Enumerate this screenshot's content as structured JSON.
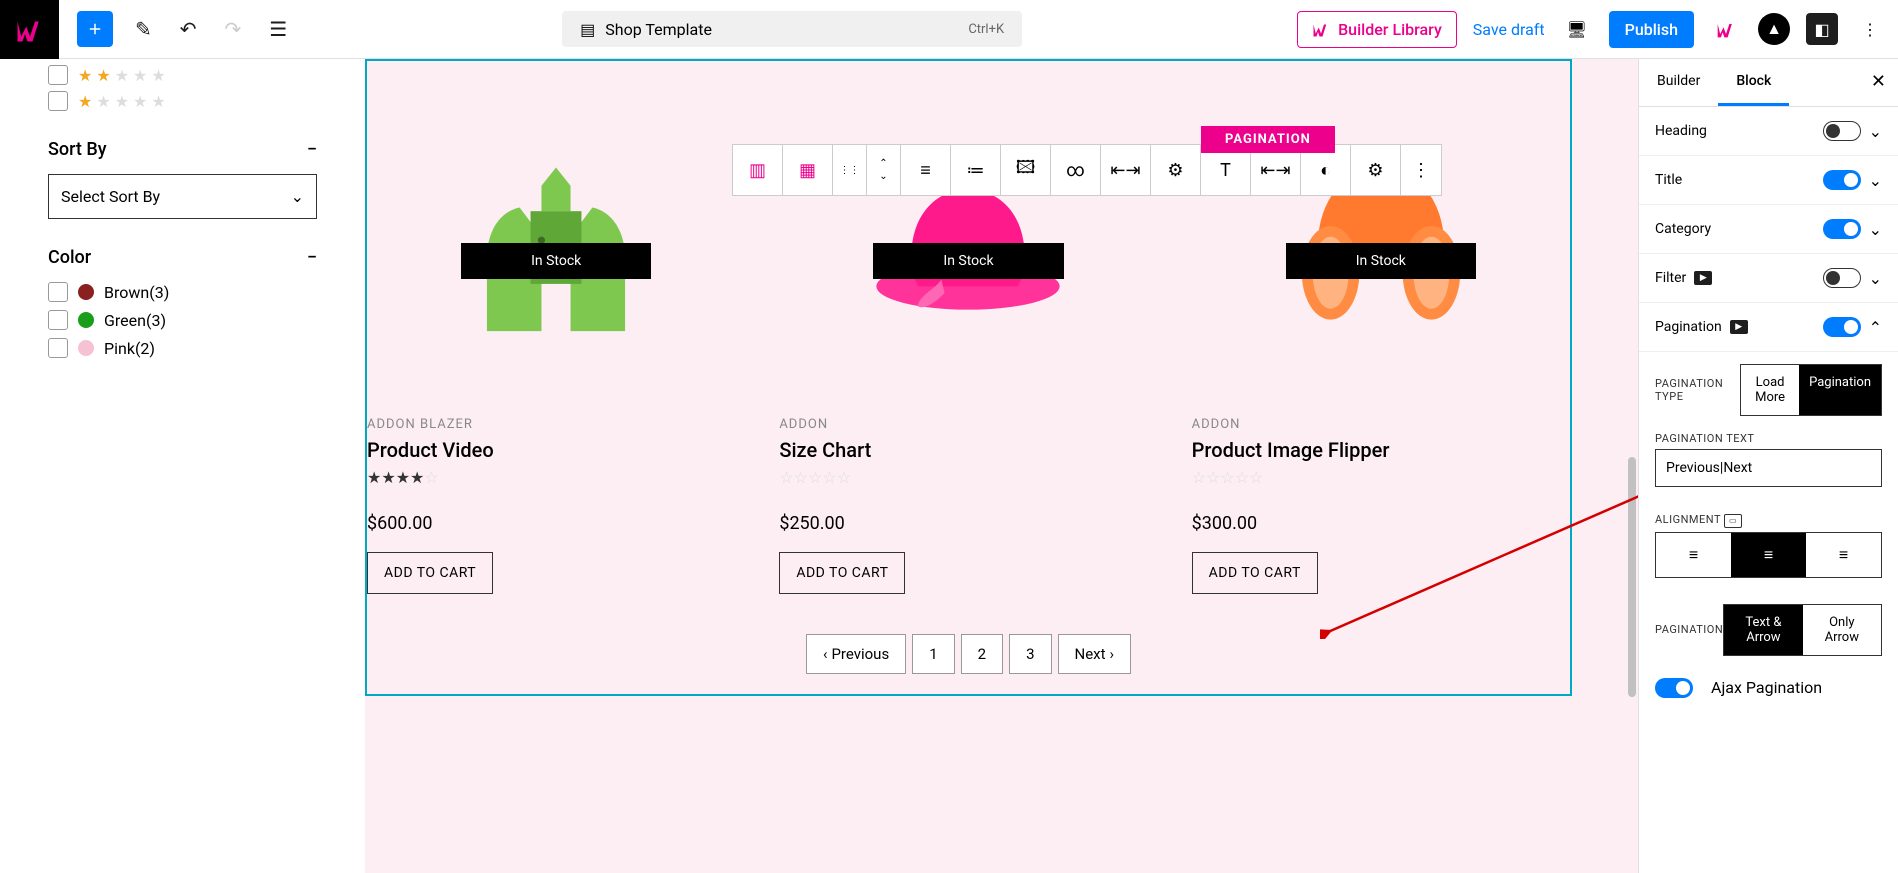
{
  "topbar": {
    "template_label": "Shop Template",
    "shortcut": "Ctrl+K",
    "builder_library": "Builder Library",
    "save_draft": "Save draft",
    "publish": "Publish"
  },
  "filters": {
    "sort_by_label": "Sort By",
    "sort_placeholder": "Select Sort By",
    "color_label": "Color",
    "colors": [
      {
        "name": "Brown",
        "count": 3,
        "hex": "#8b2020"
      },
      {
        "name": "Green",
        "count": 3,
        "hex": "#1a9e1a"
      },
      {
        "name": "Pink",
        "count": 2,
        "hex": "#f7c1d4"
      }
    ]
  },
  "pagination_label": "PAGINATION",
  "products": [
    {
      "category": "ADDON  BLAZER",
      "title": "Product Video",
      "price": "$600.00",
      "rating": 4,
      "instock": "In Stock",
      "cart": "ADD TO CART"
    },
    {
      "category": "ADDON",
      "title": "Size Chart",
      "price": "$250.00",
      "rating": 0,
      "instock": "In Stock",
      "cart": "ADD TO CART"
    },
    {
      "category": "ADDON",
      "title": "Product Image Flipper",
      "price": "$300.00",
      "rating": 0,
      "instock": "In Stock",
      "cart": "ADD TO CART"
    }
  ],
  "pagination": {
    "prev": "Previous",
    "next": "Next",
    "pages": [
      "1",
      "2",
      "3"
    ]
  },
  "inspector": {
    "tab_builder": "Builder",
    "tab_block": "Block",
    "rows": {
      "heading": "Heading",
      "title": "Title",
      "category": "Category",
      "filter": "Filter",
      "pagination": "Pagination"
    },
    "pag_type_label": "PAGINATION TYPE",
    "pag_type_loadmore": "Load More",
    "pag_type_pagination": "Pagination",
    "pag_text_label": "PAGINATION TEXT",
    "pag_text_value": "Previous|Next",
    "alignment_label": "ALIGNMENT",
    "pag_style_label": "PAGINATION",
    "pag_style_text": "Text & Arrow",
    "pag_style_arrow": "Only Arrow",
    "ajax": "Ajax Pagination"
  }
}
